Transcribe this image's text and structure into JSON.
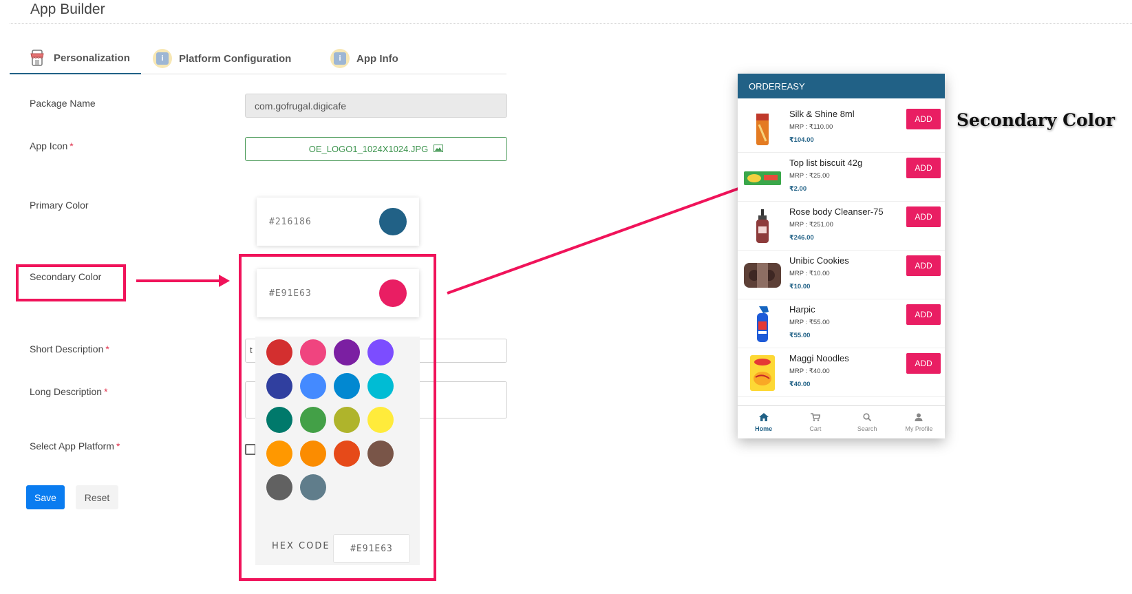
{
  "app": {
    "title": "App Builder"
  },
  "tabs": [
    {
      "label": "Personalization",
      "icon": "store-icon",
      "active": true
    },
    {
      "label": "Platform Configuration",
      "icon": "info-icon",
      "active": false
    },
    {
      "label": "App Info",
      "icon": "info-icon",
      "active": false
    }
  ],
  "form": {
    "package_name": {
      "label": "Package Name",
      "value": "com.gofrugal.digicafe"
    },
    "app_icon": {
      "label": "App Icon",
      "required": "*",
      "value": "OE_LOGO1_1024X1024.JPG",
      "icon": "image-icon"
    },
    "primary_color": {
      "label": "Primary Color",
      "value": "#216186",
      "color": "#216186"
    },
    "secondary_color": {
      "label": "Secondary Color",
      "value": "#E91E63",
      "color": "#E91E63"
    },
    "short_description": {
      "label": "Short Description",
      "required": "*",
      "value": "t"
    },
    "long_description": {
      "label": "Long Description",
      "required": "*",
      "value": ""
    },
    "select_platform": {
      "label": "Select App Platform",
      "required": "*"
    },
    "save_label": "Save",
    "reset_label": "Reset"
  },
  "color_picker": {
    "swatches": [
      "#D32F2F",
      "#F0447F",
      "#7B1FA2",
      "#7C4DFF",
      "#303F9F",
      "#448AFF",
      "#0288D1",
      "#00BCD4",
      "#00796B",
      "#43A047",
      "#AFB42B",
      "#FFEB3B",
      "#FF9800",
      "#FB8C00",
      "#E64A19",
      "#795548",
      "#616161",
      "#607D8B"
    ],
    "hex_label": "HEX CODE",
    "hex_value": "#E91E63"
  },
  "preview": {
    "header": "ORDEREASY",
    "primary": "#216186",
    "secondary": "#E91E63",
    "add_label": "ADD",
    "products": [
      {
        "name": "Silk & Shine 8ml",
        "mrp": "MRP : ₹110.00",
        "price": "₹104.00"
      },
      {
        "name": "Top list biscuit 42g",
        "mrp": "MRP : ₹25.00",
        "price": "₹2.00"
      },
      {
        "name": "Rose body Cleanser-75",
        "mrp": "MRP : ₹251.00",
        "price": "₹246.00"
      },
      {
        "name": "Unibic Cookies",
        "mrp": "MRP : ₹10.00",
        "price": "₹10.00"
      },
      {
        "name": "Harpic",
        "mrp": "MRP : ₹55.00",
        "price": "₹55.00"
      },
      {
        "name": "Maggi Noodles",
        "mrp": "MRP : ₹40.00",
        "price": "₹40.00"
      }
    ],
    "nav": [
      {
        "label": "Home",
        "icon": "home-icon",
        "active": true
      },
      {
        "label": "Cart",
        "icon": "cart-icon",
        "active": false
      },
      {
        "label": "Search",
        "icon": "search-icon",
        "active": false
      },
      {
        "label": "My Profile",
        "icon": "profile-icon",
        "active": false
      }
    ]
  },
  "annotation": {
    "label": "Secondary Color",
    "color": "#F0135A"
  }
}
